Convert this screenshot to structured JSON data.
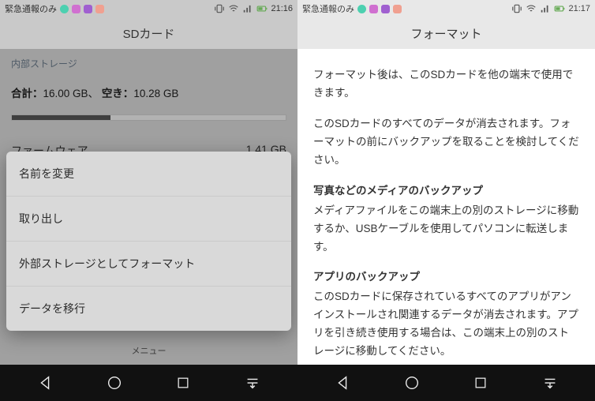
{
  "left": {
    "statusbar": {
      "carrier": "緊急通報のみ",
      "time": "21:16"
    },
    "title": "SDカード",
    "section1_header": "内部ストレージ",
    "storage_total_label": "合計：",
    "storage_total_value": "16.00 GB、",
    "storage_free_label": "空き：",
    "storage_free_value": "10.28 GB",
    "storage_used_pct": 36,
    "firmware_label": "ファームウェア",
    "firmware_size": "1.41 GB",
    "menu_label": "メニュー",
    "popup": {
      "rename": "名前を変更",
      "eject": "取り出し",
      "format_external": "外部ストレージとしてフォーマット",
      "migrate": "データを移行"
    }
  },
  "right": {
    "statusbar": {
      "carrier": "緊急通報のみ",
      "time": "21:17"
    },
    "title": "フォーマット",
    "p1": "フォーマット後は、このSDカードを他の端末で使用できます。",
    "p2": "このSDカードのすべてのデータが消去されます。フォーマットの前にバックアップを取ることを検討してください。",
    "h1": "写真などのメディアのバックアップ",
    "p3": "メディアファイルをこの端末上の別のストレージに移動するか、USBケーブルを使用してパソコンに転送します。",
    "h2": "アプリのバックアップ",
    "p4": "このSDカードに保存されているすべてのアプリがアンインストールされ関連するデータが消去されます。アプリを引き続き使用する場合は、この端末上の別のストレージに移動してください。"
  }
}
